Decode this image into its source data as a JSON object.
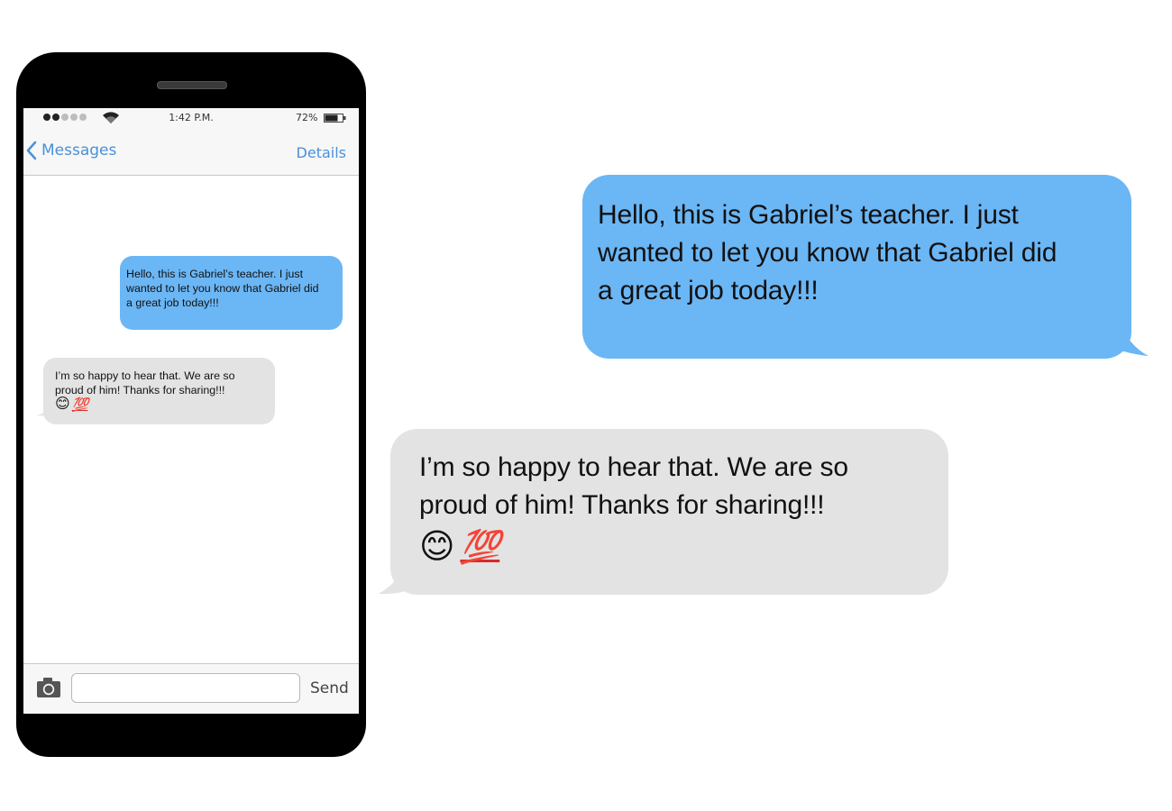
{
  "status_bar": {
    "time": "1:42 P.M.",
    "battery": "72%",
    "signal_bars_on": 2,
    "signal_bars_total": 5
  },
  "nav": {
    "back_label": "Messages",
    "details_label": "Details"
  },
  "messages": [
    {
      "direction": "sent",
      "lines": [
        "Hello, this is Gabriel’s teacher.  I just",
        "wanted to let you know that Gabriel did",
        "a great job today!!!"
      ]
    },
    {
      "direction": "received",
      "lines": [
        "I’m so happy to hear that.  We are so",
        "proud of him! Thanks for sharing!!!"
      ],
      "emoji": [
        "😊",
        "💯"
      ]
    }
  ],
  "composer": {
    "value": "",
    "send_label": "Send"
  },
  "colors": {
    "sent_bubble": "#6bb6f5",
    "received_bubble": "#e3e3e3",
    "accent": "#4a90d9"
  },
  "icons": [
    "wifi-icon",
    "battery-icon",
    "chevron-left-icon",
    "camera-icon"
  ]
}
